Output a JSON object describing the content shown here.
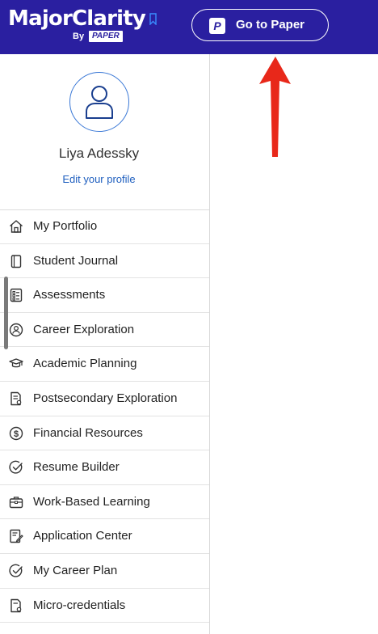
{
  "header": {
    "logo_text": "MajorClarity",
    "logo_by": "By",
    "logo_paper": "PAPER",
    "go_to_paper_label": "Go to Paper",
    "go_to_paper_icon_letter": "P",
    "brand_color": "#2a1fa0"
  },
  "profile": {
    "name": "Liya Adessky",
    "edit_label": "Edit your profile",
    "avatar_icon": "user-icon"
  },
  "nav": {
    "items": [
      {
        "label": "My Portfolio",
        "icon": "home-icon"
      },
      {
        "label": "Student Journal",
        "icon": "journal-icon"
      },
      {
        "label": "Assessments",
        "icon": "checklist-icon"
      },
      {
        "label": "Career Exploration",
        "icon": "person-circle-icon"
      },
      {
        "label": "Academic Planning",
        "icon": "graduation-cap-icon"
      },
      {
        "label": "Postsecondary Exploration",
        "icon": "document-pin-icon"
      },
      {
        "label": "Financial Resources",
        "icon": "dollar-icon"
      },
      {
        "label": "Resume Builder",
        "icon": "check-circle-icon"
      },
      {
        "label": "Work-Based Learning",
        "icon": "briefcase-icon"
      },
      {
        "label": "Application Center",
        "icon": "edit-document-icon"
      },
      {
        "label": "My Career Plan",
        "icon": "check-circle-icon"
      },
      {
        "label": "Micro-credentials",
        "icon": "document-badge-icon"
      }
    ]
  },
  "annotation": {
    "arrow_color": "#e8281a",
    "arrow_icon": "arrow-up-icon"
  }
}
